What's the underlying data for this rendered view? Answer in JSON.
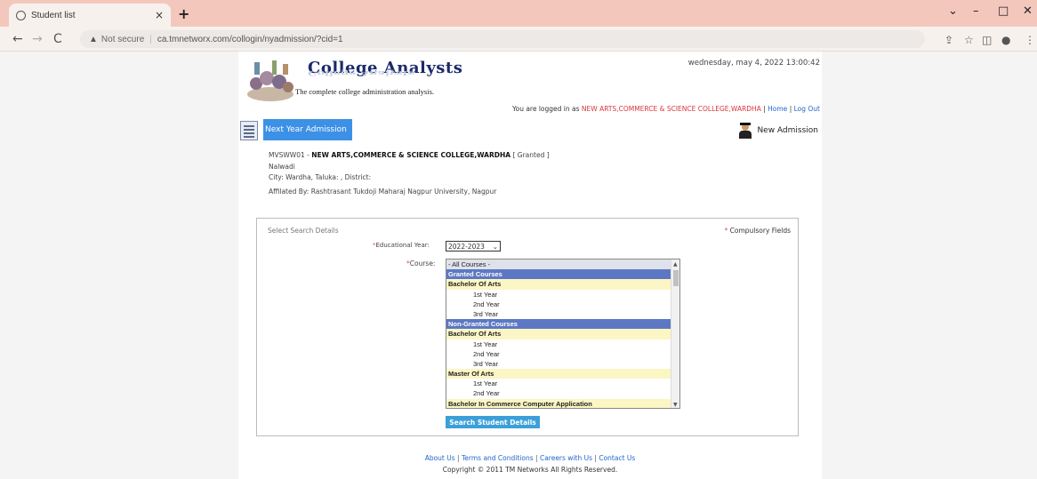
{
  "browser": {
    "tab_title": "Student list",
    "tab_close": "×",
    "new_tab": "+",
    "not_secure": "Not secure",
    "url": "ca.tmnetworx.com/collogin/nyadmission/?cid=1",
    "window_controls": [
      "⌄",
      "–",
      "□",
      "✕"
    ]
  },
  "header": {
    "logo_title": "College Analysts",
    "logo_reflection": "College Analysts",
    "logo_tagline": "The complete college administration analysis.",
    "datetime": "wednesday, may 4, 2022 13:00:42",
    "logged_in_prefix": "You are logged in as",
    "logged_in_college": "NEW ARTS,COMMERCE & SCIENCE COLLEGE,WARDHA",
    "home_link": "Home",
    "logout_link": "Log Out",
    "separator": "|"
  },
  "toolbar": {
    "next_year_admission": "Next Year Admission",
    "new_admission": "New Admission"
  },
  "college": {
    "code": "MVSWW01 -",
    "name": "NEW ARTS,COMMERCE & SCIENCE COLLEGE,WARDHA",
    "status": "[ Granted ]",
    "locality": "Nalwadi",
    "city_line": "City: Wardha, Taluka: , District:",
    "affiliation": "Affilated By: Rashtrasant Tukdoji Maharaj Nagpur University, Nagpur"
  },
  "search": {
    "select_label": "Select Search Details",
    "compulsory_star": "*",
    "compulsory_label": "Compulsory Fields",
    "edu_year_label": "Educational Year:",
    "edu_year_value": "2022-2023",
    "course_label": "Course:",
    "course_options": [
      {
        "label": "- All Courses -",
        "kind": "sel"
      },
      {
        "label": "Granted Courses",
        "kind": "group"
      },
      {
        "label": "Bachelor Of Arts",
        "kind": "program"
      },
      {
        "label": "1st Year",
        "kind": "year"
      },
      {
        "label": "2nd Year",
        "kind": "year"
      },
      {
        "label": "3rd Year",
        "kind": "year"
      },
      {
        "label": "Non-Granted Courses",
        "kind": "group"
      },
      {
        "label": "Bachelor Of Arts",
        "kind": "program"
      },
      {
        "label": "1st Year",
        "kind": "year"
      },
      {
        "label": "2nd Year",
        "kind": "year"
      },
      {
        "label": "3rd Year",
        "kind": "year"
      },
      {
        "label": "Master Of Arts",
        "kind": "program"
      },
      {
        "label": "1st Year",
        "kind": "year"
      },
      {
        "label": "2nd Year",
        "kind": "year"
      },
      {
        "label": "Bachelor In Commerce Computer Application",
        "kind": "program"
      }
    ],
    "search_button": "Search Student Details"
  },
  "footer": {
    "about": "About Us",
    "terms": "Terms and Conditions",
    "careers": "Careers with Us",
    "contact": "Contact Us",
    "sep": "|",
    "copyright": "Copyright © 2011 TM Networks All Rights Reserved."
  }
}
